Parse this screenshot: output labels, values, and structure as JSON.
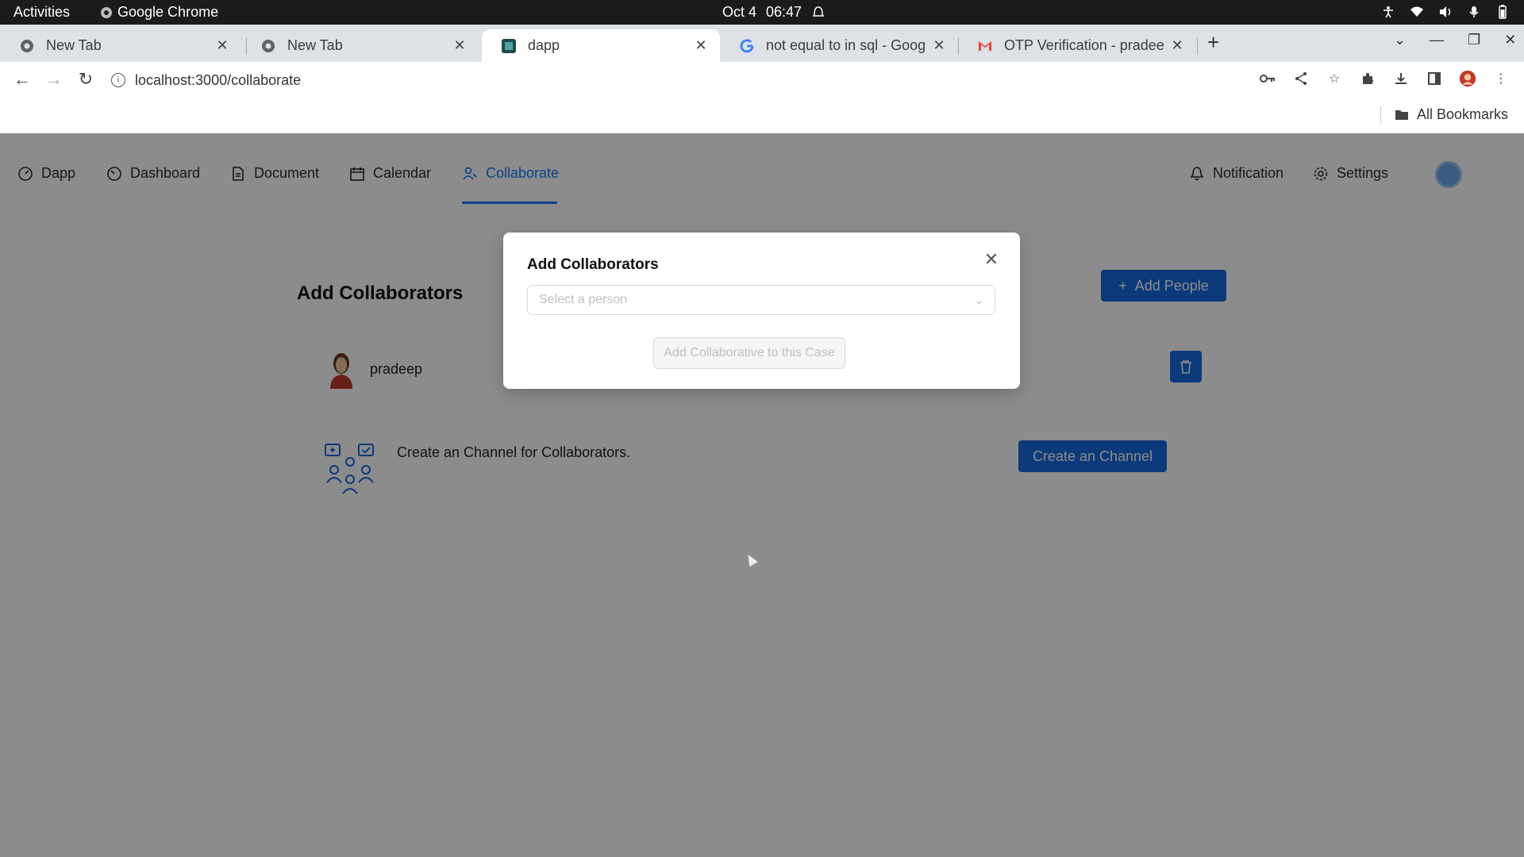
{
  "os": {
    "activities": "Activities",
    "app_name": "Google Chrome",
    "date": "Oct 4",
    "time": "06:47"
  },
  "browser": {
    "tabs": [
      {
        "label": "New Tab",
        "favicon": "chrome-icon"
      },
      {
        "label": "New Tab",
        "favicon": "chrome-icon"
      },
      {
        "label": "dapp",
        "favicon": "dapp-icon",
        "active": true
      },
      {
        "label": "not equal to in sql - Goog",
        "favicon": "google-icon"
      },
      {
        "label": "OTP Verification - pradee",
        "favicon": "gmail-icon"
      }
    ],
    "url": "localhost:3000/collaborate",
    "bookmarks_label": "All Bookmarks"
  },
  "app": {
    "nav": [
      {
        "label": "Dapp",
        "icon": "dapp-icon"
      },
      {
        "label": "Dashboard",
        "icon": "dashboard-icon"
      },
      {
        "label": "Document",
        "icon": "document-icon"
      },
      {
        "label": "Calendar",
        "icon": "calendar-icon"
      },
      {
        "label": "Collaborate",
        "icon": "collaborate-icon",
        "active": true
      }
    ],
    "right_nav": [
      {
        "label": "Notification",
        "icon": "bell-icon"
      },
      {
        "label": "Settings",
        "icon": "gear-icon"
      }
    ],
    "accent": "#1677ff",
    "page_title": "Add Collaborators",
    "add_people_label": "Add People",
    "collaborators": [
      {
        "name": "pradeep"
      }
    ],
    "channel_text": "Create an Channel for Collaborators.",
    "create_channel_label": "Create an Channel"
  },
  "modal": {
    "title": "Add Collaborators",
    "select_placeholder": "Select a person",
    "submit_label": "Add Collaborative to this Case"
  }
}
